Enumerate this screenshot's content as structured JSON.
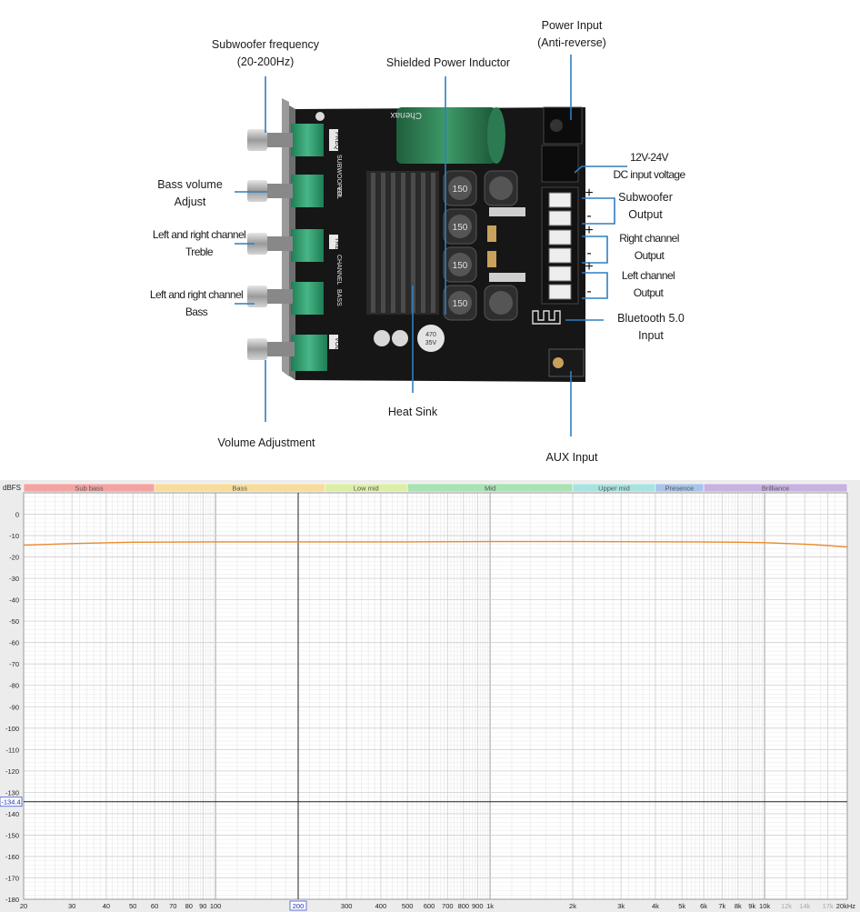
{
  "diagram": {
    "labels": {
      "subwoofer_frequency": [
        "Subwoofer frequency",
        "(20-200Hz)"
      ],
      "shielded_power_inductor": [
        "Shielded Power Inductor"
      ],
      "power_input": [
        "Power Input",
        "(Anti-reverse)"
      ],
      "dc_input": [
        "12V-24V",
        "DC input voltage"
      ],
      "bass_volume": [
        "Bass volume",
        "Adjust"
      ],
      "subwoofer_output": [
        "Subwoofer",
        "Output"
      ],
      "lr_treble": [
        "Left and right channel",
        "Treble"
      ],
      "right_output": [
        "Right channel",
        "Output"
      ],
      "lr_bass": [
        "Left and right channel",
        "Bass"
      ],
      "left_output": [
        "Left channel",
        "Output"
      ],
      "bluetooth": [
        "Bluetooth 5.0",
        "Input"
      ],
      "heat_sink": [
        "Heat Sink"
      ],
      "volume_adjustment": [
        "Volume Adjustment"
      ],
      "aux_input": [
        "AUX Input"
      ]
    },
    "terminal_signs": [
      "+",
      "-",
      "+",
      "-",
      "+",
      "-"
    ],
    "board_silkscreen": [
      "FREQ",
      "SUBWOOFER",
      "VOL",
      "TRE",
      "CHANNEL",
      "BASS",
      "VOL"
    ],
    "inductor_text": "150",
    "capacitor_text": [
      "470",
      "35V"
    ],
    "colors": {
      "leader_line": "#2f7fc1",
      "board": "#151515",
      "pot_green": "#2e9a6e",
      "knob": "#a9a9a9"
    }
  },
  "chart_data": {
    "type": "line",
    "ylabel": "dBFS",
    "x_scale": "log",
    "xlim": [
      20,
      20000
    ],
    "ylim": [
      -180,
      10
    ],
    "y_ticks": [
      0,
      -10,
      -20,
      -30,
      -40,
      -50,
      -60,
      -70,
      -80,
      -90,
      -100,
      -110,
      -120,
      -130,
      -140,
      -150,
      -160,
      -170,
      -180
    ],
    "y_tick_labels": [
      "0",
      "-10",
      "-20",
      "-30",
      "-40",
      "-50",
      "-60",
      "-70",
      "-80",
      "-90",
      "-100",
      "-110",
      "-120",
      "-130",
      "-140",
      "-150",
      "-160",
      "-170",
      "-180"
    ],
    "x_ticks": [
      20,
      30,
      40,
      50,
      60,
      70,
      80,
      90,
      100,
      200,
      300,
      400,
      500,
      600,
      700,
      800,
      900,
      1000,
      2000,
      3000,
      4000,
      5000,
      6000,
      7000,
      8000,
      9000,
      10000,
      12000,
      14000,
      17000,
      20000
    ],
    "x_tick_labels": [
      "20",
      "30",
      "40",
      "50",
      "60",
      "70",
      "80",
      "90",
      "100",
      "200",
      "300",
      "400",
      "500",
      "600",
      "700",
      "800",
      "900",
      "1k",
      "2k",
      "3k",
      "4k",
      "5k",
      "6k",
      "7k",
      "8k",
      "9k",
      "10k",
      "12k",
      "14k",
      "17k",
      "20kHz"
    ],
    "dim_x_ticks": [
      12000,
      14000,
      17000
    ],
    "bands": [
      {
        "name": "Sub bass",
        "from": 20,
        "to": 60,
        "color": "#f4a3a3"
      },
      {
        "name": "Bass",
        "from": 60,
        "to": 250,
        "color": "#f8dc9a"
      },
      {
        "name": "Low mid",
        "from": 250,
        "to": 500,
        "color": "#dcefa6"
      },
      {
        "name": "Mid",
        "from": 500,
        "to": 2000,
        "color": "#a9e2b3"
      },
      {
        "name": "Upper mid",
        "from": 2000,
        "to": 4000,
        "color": "#a9e3e1"
      },
      {
        "name": "Presence",
        "from": 4000,
        "to": 6000,
        "color": "#a9c4ea"
      },
      {
        "name": "Brilliance",
        "from": 6000,
        "to": 20000,
        "color": "#c7b2e2"
      }
    ],
    "cursor": {
      "x": 200,
      "y": -134.4,
      "x_label": "200",
      "y_label": "-134.4"
    },
    "series": [
      {
        "color": "#e8892a",
        "x": [
          20,
          30,
          50,
          100,
          200,
          500,
          1000,
          2000,
          5000,
          8000,
          10000,
          15000,
          20000
        ],
        "y": [
          -14.5,
          -13.7,
          -13.1,
          -12.9,
          -12.9,
          -12.9,
          -12.8,
          -12.8,
          -12.9,
          -13.1,
          -13.3,
          -14.2,
          -15.3
        ]
      }
    ]
  }
}
